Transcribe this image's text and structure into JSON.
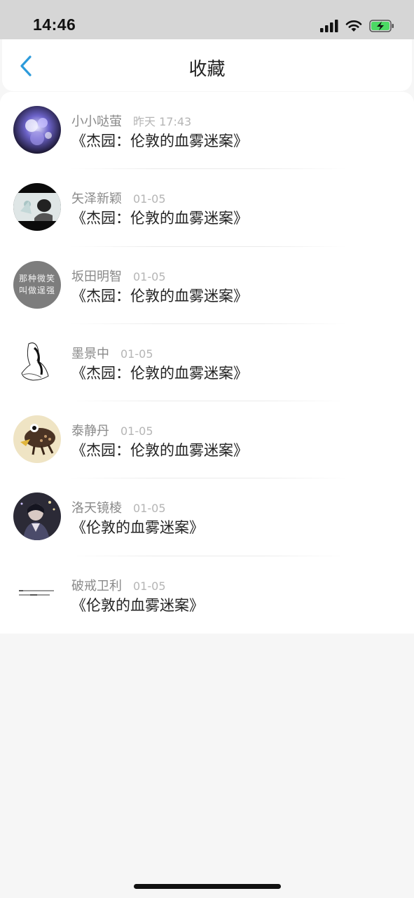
{
  "status_bar": {
    "time": "14:46"
  },
  "nav": {
    "title": "收藏"
  },
  "items": [
    {
      "name": "小小哒萤",
      "date": "昨天 17:43",
      "title": "《杰园：伦敦的血雾迷案》",
      "avatar_text": ""
    },
    {
      "name": "矢泽新颖",
      "date": "01-05",
      "title": "《杰园：伦敦的血雾迷案》",
      "avatar_text": ""
    },
    {
      "name": "坂田明智",
      "date": "01-05",
      "title": "《杰园：伦敦的血雾迷案》",
      "avatar_text": "那种微笑 叫做逞强"
    },
    {
      "name": "墨景中",
      "date": "01-05",
      "title": "《杰园：伦敦的血雾迷案》",
      "avatar_text": ""
    },
    {
      "name": "泰静丹",
      "date": "01-05",
      "title": "《杰园：伦敦的血雾迷案》",
      "avatar_text": ""
    },
    {
      "name": "洛天镜棱",
      "date": "01-05",
      "title": "《伦敦的血雾迷案》",
      "avatar_text": ""
    },
    {
      "name": "破戒卫利",
      "date": "01-05",
      "title": "《伦敦的血雾迷案》",
      "avatar_text": ""
    }
  ]
}
